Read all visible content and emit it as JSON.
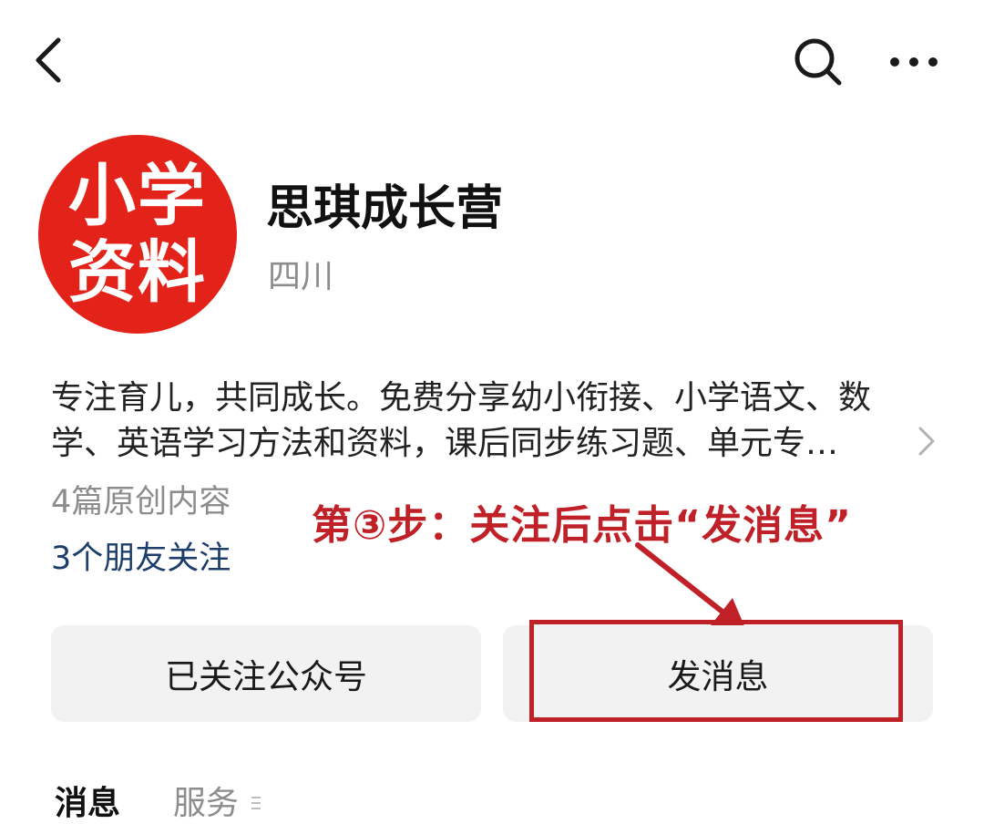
{
  "header": {
    "back_icon": "chevron-left-icon",
    "search_icon": "search-icon",
    "more_icon": "more-dots-icon"
  },
  "account": {
    "avatar": {
      "line1": "小学",
      "line2": "资料",
      "bg_color": "#e3231a"
    },
    "name": "思琪成长营",
    "region": "四川",
    "description": "专注育儿，共同成长。免费分享幼小衔接、小学语文、数学、英语学习方法和资料，课后同步练习题、单元专…",
    "original_count": "4篇原创内容",
    "friends_following": "3个朋友关注"
  },
  "annotation": {
    "text": "第③步：关注后点击“发消息”",
    "color": "#c02027"
  },
  "actions": {
    "followed_label": "已关注公众号",
    "message_label": "发消息"
  },
  "tabs": {
    "messages": "消息",
    "services": "服务"
  }
}
